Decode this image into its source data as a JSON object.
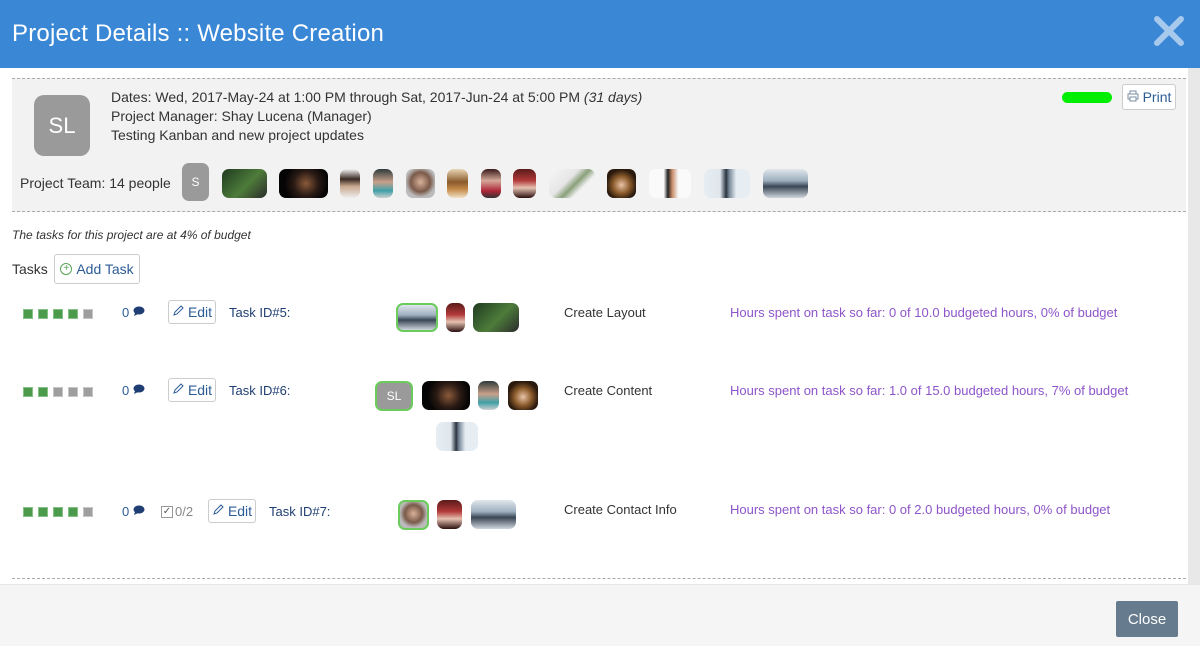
{
  "modal": {
    "title": "Project Details :: Website Creation",
    "close_icon": "close-icon"
  },
  "project": {
    "avatar_initials": "SL",
    "dates_prefix": "Dates: Wed, 2017-May-24 at 1:00 PM through Sat, 2017-Jun-24 at 5:00 PM",
    "dates_duration": "(31 days)",
    "manager": "Project Manager: Shay Lucena (Manager)",
    "description": "Testing Kanban and new project updates",
    "progress_color": "#00ee00",
    "print_label": "Print",
    "team_label": "Project Team: 14 people",
    "team_first_initial": "S"
  },
  "budget_note": "The tasks for this project are at 4% of budget",
  "tasks_section": {
    "label": "Tasks",
    "add_task_label": "Add Task"
  },
  "tasks": [
    {
      "comments": "0",
      "edit_label": "Edit",
      "task_id": "Task ID#5:",
      "name": "Create Layout",
      "hours": "Hours spent on task so far: 0 of 10.0 budgeted hours, 0% of budget",
      "progress_steps": [
        true,
        true,
        true,
        true,
        false
      ],
      "checklist": ""
    },
    {
      "comments": "0",
      "edit_label": "Edit",
      "task_id": "Task ID#6:",
      "name": "Create Content",
      "hours": "Hours spent on task so far: 1.0 of 15.0 budgeted hours, 7% of budget",
      "progress_steps": [
        true,
        true,
        false,
        false,
        false
      ],
      "checklist": "",
      "owner_initials": "SL"
    },
    {
      "comments": "0",
      "edit_label": "Edit",
      "task_id": "Task ID#7:",
      "name": "Create Contact Info",
      "hours": "Hours spent on task so far: 0 of 2.0 budgeted hours, 0% of budget",
      "progress_steps": [
        true,
        true,
        true,
        true,
        false
      ],
      "checklist": "0/2"
    }
  ],
  "footer": {
    "close_label": "Close"
  },
  "colors": {
    "header": "#3a87d6",
    "link": "#2c5c96",
    "hours": "#8e55c9",
    "owner_border": "#6bcb5b"
  }
}
